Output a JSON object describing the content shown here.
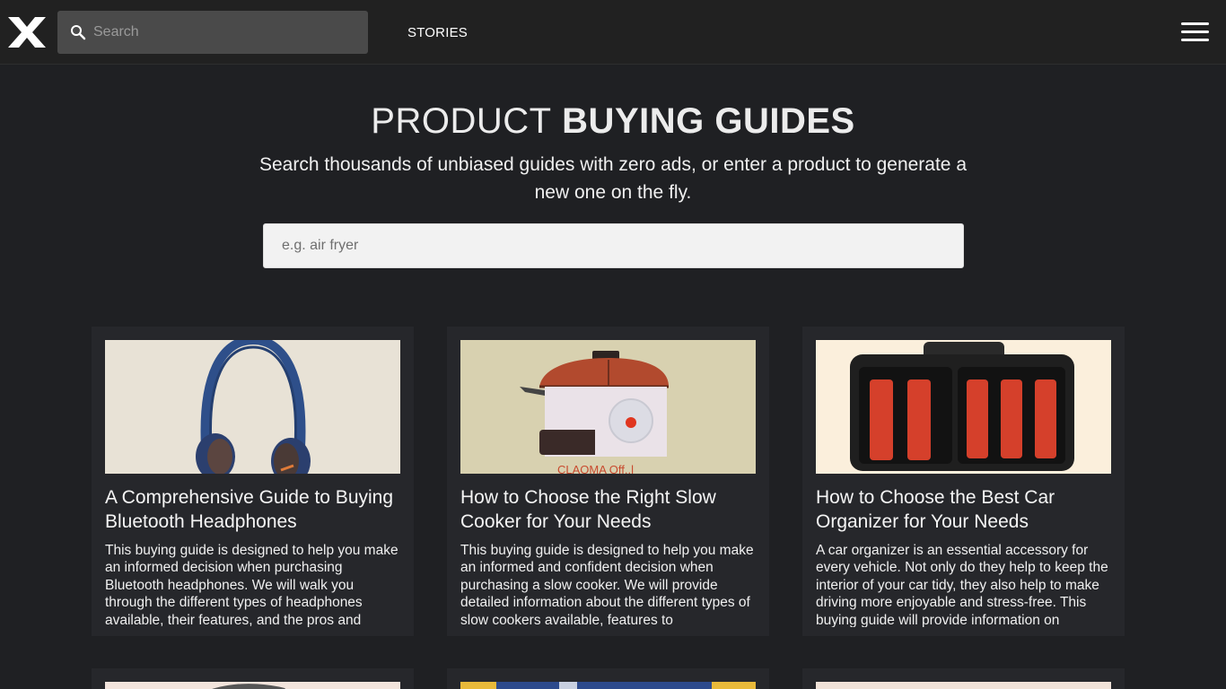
{
  "header": {
    "logo_icon": "x-logo-icon",
    "search_placeholder": "Search",
    "nav_stories": "STORIES",
    "menu_icon": "hamburger-menu-icon"
  },
  "hero": {
    "title_light": "PRODUCT",
    "title_bold": "BUYING GUIDES",
    "subtitle": "Search thousands of unbiased guides with zero ads, or enter a product to generate a new one on the fly.",
    "input_placeholder": "e.g. air fryer"
  },
  "cards": [
    {
      "title": "A Comprehensive Guide to Buying Bluetooth Headphones",
      "description": "This buying guide is designed to help you make an informed decision when purchasing Bluetooth headphones. We will walk you through the different types of headphones available, their features, and the pros and",
      "image": "headphones-illustration"
    },
    {
      "title": "How to Choose the Right Slow Cooker for Your Needs",
      "description": "This buying guide is designed to help you make an informed and confident decision when purchasing a slow cooker. We will provide detailed information about the different types of slow cookers available, features to",
      "image": "slow-cooker-illustration",
      "image_caption": "CLAOMA Off..l"
    },
    {
      "title": "How to Choose the Best Car Organizer for Your Needs",
      "description": "A car organizer is an essential accessory for every vehicle. Not only do they help to keep the interior of your car tidy, they also help to make driving more enjoyable and stress-free. This buying guide will provide information on",
      "image": "car-organizer-illustration"
    }
  ],
  "colors": {
    "background": "#1f2023",
    "topbar": "#212121",
    "card": "#26272b",
    "search_field": "#4a4a4a"
  }
}
